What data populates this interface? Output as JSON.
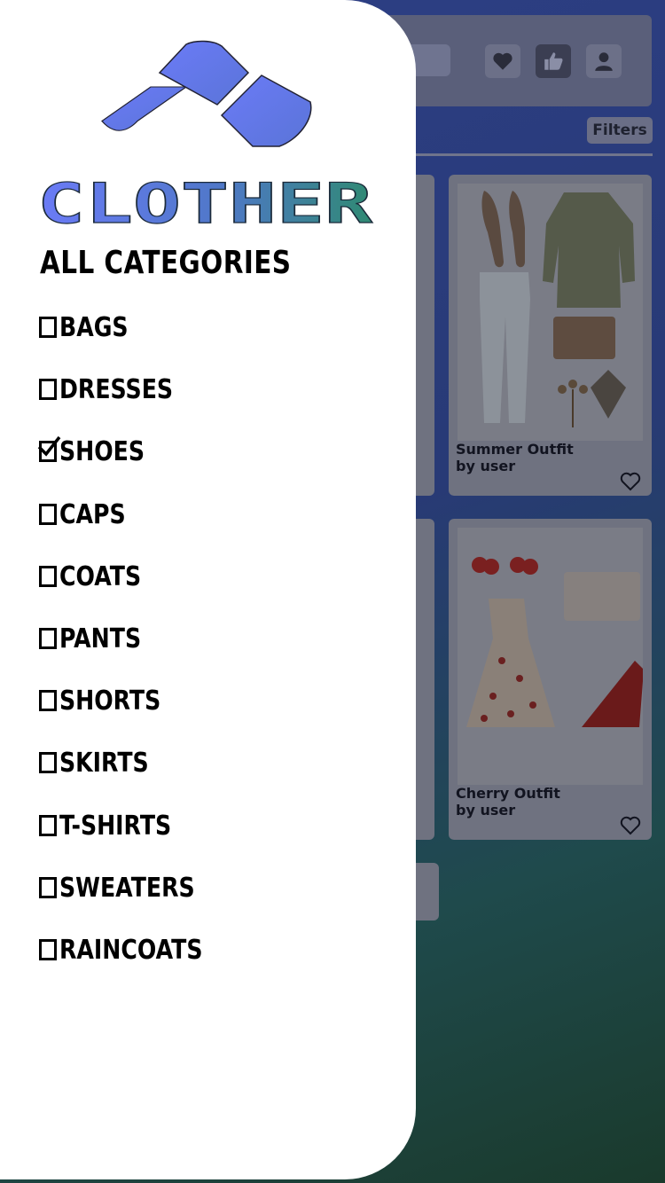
{
  "app": {
    "name": "CLOTHER",
    "brand_color": "#6b7bf7",
    "brand_gradient_end": "#2f8a72"
  },
  "header": {
    "icons": [
      "heart-icon",
      "thumbs-up-icon",
      "user-icon"
    ],
    "filters_label": "Filters"
  },
  "feed": {
    "cards": [
      {
        "title": "Summer Outfit",
        "author": "by user"
      },
      {
        "title": "Cherry Outfit",
        "author": "by user"
      }
    ]
  },
  "drawer": {
    "heading": "ALL CATEGORIES",
    "categories": [
      {
        "label": "BAGS",
        "checked": false
      },
      {
        "label": "DRESSES",
        "checked": false
      },
      {
        "label": "SHOES",
        "checked": true
      },
      {
        "label": "CAPS",
        "checked": false
      },
      {
        "label": "COATS",
        "checked": false
      },
      {
        "label": "PANTS",
        "checked": false
      },
      {
        "label": "SHORTS",
        "checked": false
      },
      {
        "label": "SKIRTS",
        "checked": false
      },
      {
        "label": "T-SHIRTS",
        "checked": false
      },
      {
        "label": "SWEATERS",
        "checked": false
      },
      {
        "label": "RAINCOATS",
        "checked": false
      }
    ]
  }
}
